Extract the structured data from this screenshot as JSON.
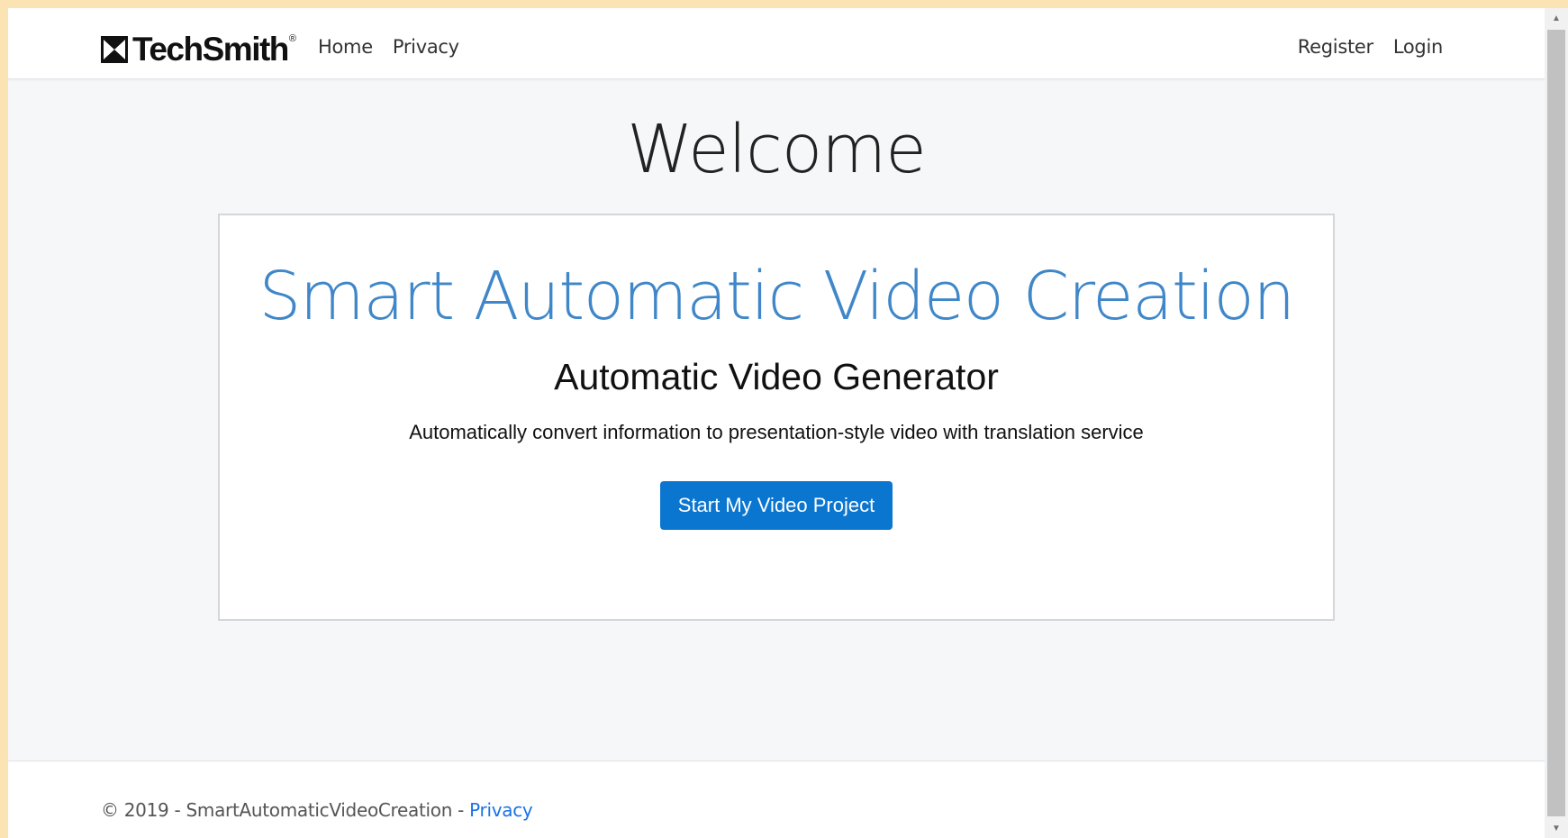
{
  "header": {
    "brand": {
      "name": "TechSmith",
      "reg_mark": "®",
      "icon": "techsmith-logo-icon"
    },
    "nav_left": [
      {
        "label": "Home"
      },
      {
        "label": "Privacy"
      }
    ],
    "nav_right": [
      {
        "label": "Register"
      },
      {
        "label": "Login"
      }
    ]
  },
  "main": {
    "heading": "Welcome",
    "card": {
      "title": "Smart Automatic Video Creation",
      "subtitle": "Automatic Video Generator",
      "description": "Automatically convert information to presentation-style video with translation service",
      "button_label": "Start My Video Project"
    }
  },
  "footer": {
    "text": "© 2019 - SmartAutomaticVideoCreation - ",
    "link_label": "Privacy"
  },
  "scrollbar": {
    "up_glyph": "▲",
    "down_glyph": "▼"
  },
  "colors": {
    "accent_blue": "#3f87c9",
    "button_blue": "#0b76d0",
    "link_blue": "#1a73e8",
    "page_background": "#f6f7f8",
    "outer_frame": "#fbe3b4"
  }
}
